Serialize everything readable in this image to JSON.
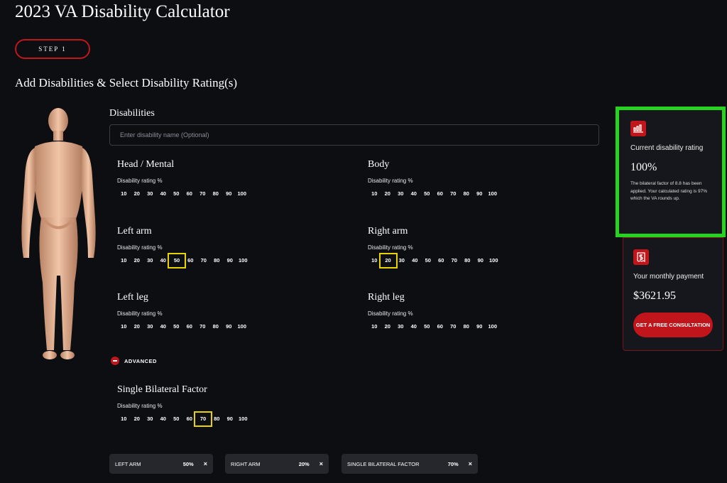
{
  "header": {
    "title": "2023 VA Disability Calculator",
    "step_label": "STEP 1",
    "section_title": "Add Disabilities & Select Disability Rating(s)"
  },
  "disabilities": {
    "label": "Disabilities",
    "input_placeholder": "Enter disability name (Optional)",
    "input_value": ""
  },
  "rating_sub_label": "Disability rating %",
  "rating_options": [
    "10",
    "20",
    "30",
    "40",
    "50",
    "60",
    "70",
    "80",
    "90",
    "100"
  ],
  "groups": {
    "head": {
      "title": "Head / Mental",
      "selected": null
    },
    "body": {
      "title": "Body",
      "selected": null
    },
    "left_arm": {
      "title": "Left arm",
      "selected": "50"
    },
    "right_arm": {
      "title": "Right arm",
      "selected": "20"
    },
    "left_leg": {
      "title": "Left leg",
      "selected": null
    },
    "right_leg": {
      "title": "Right leg",
      "selected": null
    },
    "bilateral": {
      "title": "Single Bilateral Factor",
      "selected": "70"
    }
  },
  "advanced_label": "ADVANCED",
  "chips": [
    {
      "label": "LEFT ARM",
      "value": "50%",
      "remove": "×"
    },
    {
      "label": "RIGHT ARM",
      "value": "20%",
      "remove": "×"
    },
    {
      "label": "SINGLE BILATERAL FACTOR",
      "value": "70%",
      "remove": "×"
    }
  ],
  "rating_card": {
    "label": "Current disability rating",
    "value": "100%",
    "note": "The bilateral factor of 8.8 has been applied. Your calculated rating is 97% which the VA rounds up."
  },
  "payment_card": {
    "label": "Your monthly payment",
    "value": "$3621.95",
    "cta": "GET A FREE CONSULTATION"
  },
  "colors": {
    "accent": "#c0161b",
    "highlight": "#24d41f",
    "selected": "#e8d200",
    "background": "#0d0e12"
  }
}
